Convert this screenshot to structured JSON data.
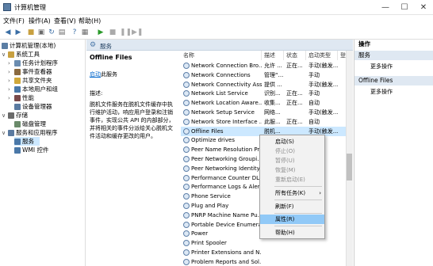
{
  "window": {
    "title": "计算机管理"
  },
  "menu": [
    "文件(F)",
    "操作(A)",
    "查看(V)",
    "帮助(H)"
  ],
  "tree": [
    {
      "label": "计算机管理(本地)",
      "expander": "",
      "icon_color": "#5b7ea4"
    },
    {
      "label": "系统工具",
      "expander": "v",
      "icon_color": "#c8a040"
    },
    {
      "label": "任务计划程序",
      "expander": ">",
      "icon_color": "#6a8cb0"
    },
    {
      "label": "事件查看器",
      "expander": ">",
      "icon_color": "#8a6a40"
    },
    {
      "label": "共享文件夹",
      "expander": ">",
      "icon_color": "#d0a83a"
    },
    {
      "label": "本地用户和组",
      "expander": ">",
      "icon_color": "#4a78a8"
    },
    {
      "label": "性能",
      "expander": ">",
      "icon_color": "#7a4a4a"
    },
    {
      "label": "设备管理器",
      "expander": "",
      "icon_color": "#5a7aa0"
    },
    {
      "label": "存储",
      "expander": "v",
      "icon_color": "#6a6a6a"
    },
    {
      "label": "磁盘管理",
      "expander": "",
      "icon_color": "#6a8a6a"
    },
    {
      "label": "服务和应用程序",
      "expander": "v",
      "icon_color": "#5a7aa0"
    },
    {
      "label": "服务",
      "expander": "",
      "icon_color": "#4a78a8"
    },
    {
      "label": "WMI 控件",
      "expander": "",
      "icon_color": "#4a78a8"
    }
  ],
  "services_header": "服务",
  "detail": {
    "title": "Offline Files",
    "link_text": "启动",
    "link_suffix": "此服务",
    "desc_label": "描述:",
    "desc_text": "脱机文件服务在脱机文件缓存中执行维护活动，响应用户登录和注销事件，实现公共 API 的内部部分，并将相关的事件分派给关心脱机文件活动和缓存更改的用户。"
  },
  "columns": [
    "名称",
    "描述",
    "状态",
    "启动类型",
    "登"
  ],
  "services": [
    {
      "name": "Network Connection Bro...",
      "desc": "允许 ...",
      "status": "正在...",
      "startup": "手动(触发..."
    },
    {
      "name": "Network Connections",
      "desc": "管理“...",
      "status": "",
      "startup": "手动"
    },
    {
      "name": "Network Connectivity Ass...",
      "desc": "提供 ...",
      "status": "",
      "startup": "手动(触发..."
    },
    {
      "name": "Network List Service",
      "desc": "识别...",
      "status": "正在...",
      "startup": "手动"
    },
    {
      "name": "Network Location Aware...",
      "desc": "收集...",
      "status": "正在...",
      "startup": "自动"
    },
    {
      "name": "Network Setup Service",
      "desc": "网络...",
      "status": "",
      "startup": "手动(触发..."
    },
    {
      "name": "Network Store Interface ...",
      "desc": "此服...",
      "status": "正在...",
      "startup": "自动"
    },
    {
      "name": "Offline Files",
      "desc": "脱机...",
      "status": "",
      "startup": "手动(触发..."
    },
    {
      "name": "Optimize drives",
      "desc": "",
      "status": "",
      "startup": ""
    },
    {
      "name": "Peer Name Resolution Pr...",
      "desc": "",
      "status": "",
      "startup": ""
    },
    {
      "name": "Peer Networking Groupi...",
      "desc": "",
      "status": "",
      "startup": ""
    },
    {
      "name": "Peer Networking Identity...",
      "desc": "",
      "status": "",
      "startup": ""
    },
    {
      "name": "Performance Counter DL...",
      "desc": "",
      "status": "",
      "startup": ""
    },
    {
      "name": "Performance Logs & Aler...",
      "desc": "",
      "status": "",
      "startup": ""
    },
    {
      "name": "Phone Service",
      "desc": "",
      "status": "",
      "startup": ""
    },
    {
      "name": "Plug and Play",
      "desc": "",
      "status": "",
      "startup": ""
    },
    {
      "name": "PNRP Machine Name Pu...",
      "desc": "",
      "status": "",
      "startup": ""
    },
    {
      "name": "Portable Device Enumera...",
      "desc": "",
      "status": "",
      "startup": ""
    },
    {
      "name": "Power",
      "desc": "",
      "status": "",
      "startup": ""
    },
    {
      "name": "Print Spooler",
      "desc": "",
      "status": "",
      "startup": ""
    },
    {
      "name": "Printer Extensions and N...",
      "desc": "",
      "status": "",
      "startup": ""
    },
    {
      "name": "Problem Reports and Sol...",
      "desc": "",
      "status": "",
      "startup": ""
    }
  ],
  "actions": {
    "header": "操作",
    "group1": "服务",
    "group1_more": "更多操作",
    "group2": "Offline Files",
    "group2_more": "更多操作"
  },
  "context_menu": {
    "start": "启动(S)",
    "stop": "停止(O)",
    "pause": "暂停(U)",
    "resume": "恢复(M)",
    "restart": "重新启动(E)",
    "all_tasks": "所有任务(K)",
    "refresh": "刷新(F)",
    "properties": "属性(R)",
    "help": "帮助(H)"
  },
  "colors": {
    "selection": "#cce8ff",
    "menu_highlight": "#91c9f7",
    "header_band": "#dfe8f2"
  }
}
